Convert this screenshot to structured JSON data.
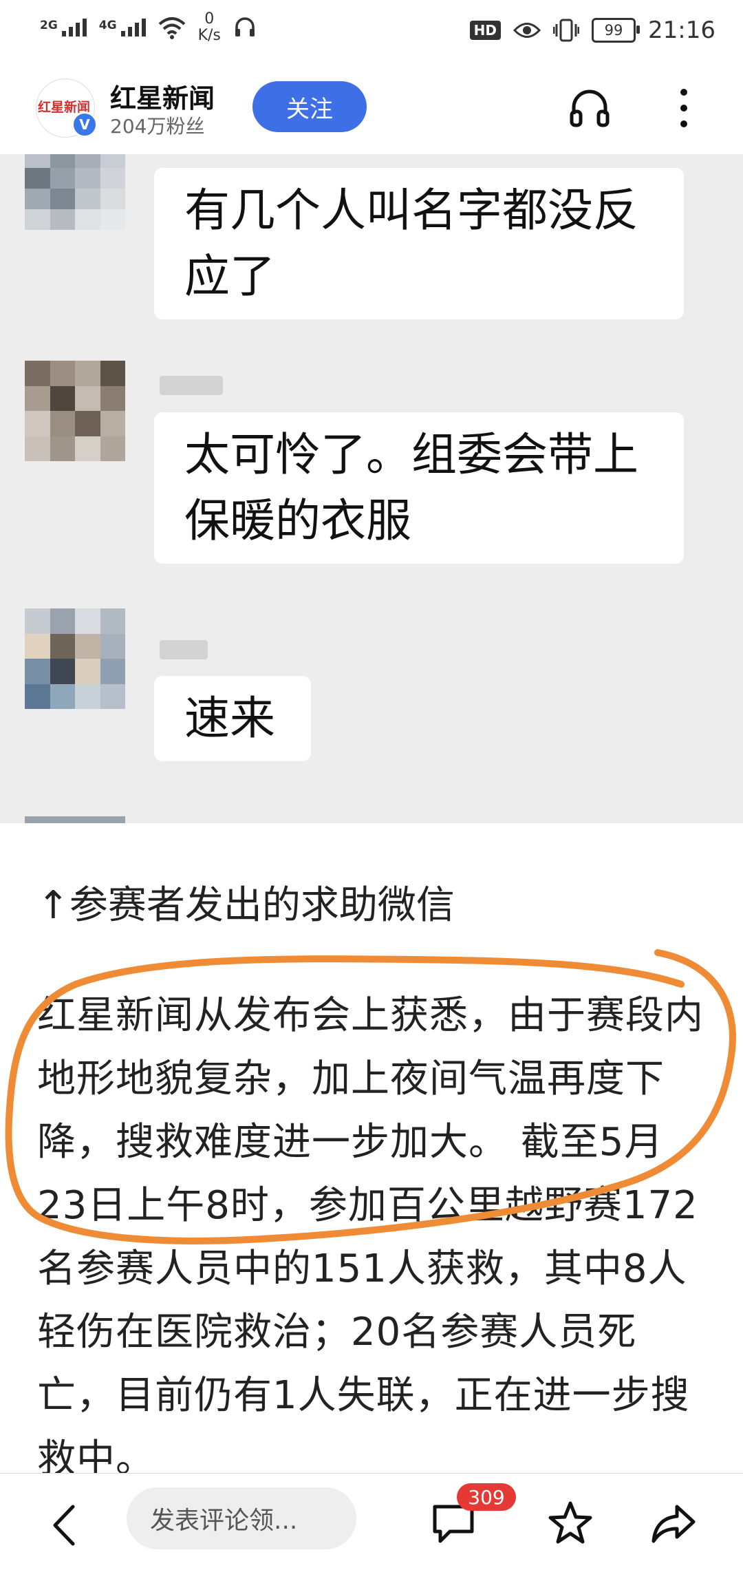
{
  "status_bar": {
    "signal1": "2G",
    "signal2": "4G",
    "net_speed_value": "0",
    "net_speed_unit": "K/s",
    "hd": "HD",
    "battery": "99",
    "time": "21:16"
  },
  "header": {
    "account_name": "红星新闻",
    "fans": "204万粉丝",
    "follow_label": "关注",
    "logo_text": "红星新闻"
  },
  "chat": {
    "messages": [
      "有几个人叫名字都没反应了",
      "太可怜了。组委会带上保暖的衣服",
      "速来"
    ]
  },
  "article": {
    "caption": "↑参赛者发出的求助微信",
    "paragraph": "红星新闻从发布会上获悉，由于赛段内地形地貌复杂，加上夜间气温再度下降，搜救难度进一步加大。 截至5月23日上午8时，参加百公里越野赛172名参赛人员中的151人获救，其中8人轻伤在医院救治；20名参赛人员死亡，目前仍有1人失联，正在进一步搜救中。"
  },
  "bottom_bar": {
    "comment_placeholder": "发表评论领...",
    "comment_count": "309"
  },
  "colors": {
    "accent_blue": "#3e6fe6",
    "badge_red": "#e53935",
    "highlight_orange": "#ef8a35"
  }
}
